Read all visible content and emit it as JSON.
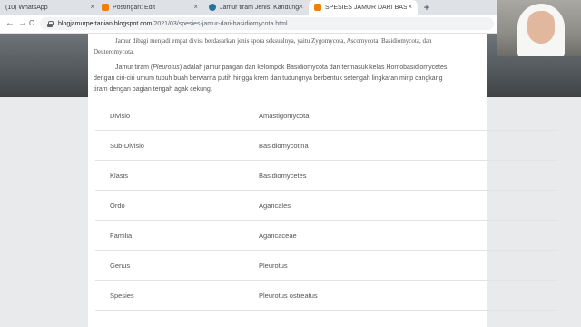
{
  "browser": {
    "tabs": [
      {
        "title": "(10) WhatsApp",
        "icon": "whatsapp-icon",
        "active": false
      },
      {
        "title": "Postingan: Edit",
        "icon": "blogger-icon",
        "active": false
      },
      {
        "title": "Jamur tiram Jenis, Kandungan, M",
        "icon": "wordpress-icon",
        "active": false
      },
      {
        "title": "SPESIES JAMUR DARI BASIDIOM",
        "icon": "blogger-icon",
        "active": true
      }
    ],
    "close_glyph": "×",
    "new_tab_glyph": "+",
    "back_glyph": "←",
    "forward_glyph": "→",
    "reload_glyph": "C",
    "url_host": "blogjamurpertanian.blogspot.com",
    "url_path": "/2021/03/spesies-jamur-dari-basidiomycota.html"
  },
  "article": {
    "para1": "Jamur dibagi menjadi empat divisi berdasarkan jenis spora seksualnya, yaitu Zygomycota, Ascomycota, Basidiomycota, dan Deuteromycota.",
    "para2_before": "Jamur tiram (",
    "para2_italic": "Pleurotus",
    "para2_after": ") adalah jamur pangan dari kelompok Basidiomycota dan termasuk kelas Homobasidiomycetes dengan ciri-ciri umum tubuh buah berwarna putih hingga krem dan tudungnya berbentuk setengah lingkaran mirip cangkang tiram dengan bagian tengah agak cekung.",
    "taxonomy": [
      {
        "rank": "Divisio",
        "value": "Amastigomycota"
      },
      {
        "rank": "Sub-Divisio",
        "value": "Basidiomycotina"
      },
      {
        "rank": "Klasis",
        "value": "Basidiomycetes"
      },
      {
        "rank": "Ordo",
        "value": "Agaricales"
      },
      {
        "rank": "Familia",
        "value": "Agaricaceae"
      },
      {
        "rank": "Genus",
        "value": "Pleurotus"
      },
      {
        "rank": "Spesies",
        "value": "Pleurotus ostreatus"
      }
    ]
  },
  "colors": {
    "tabstrip": "#dee1e6",
    "banner": "#5a5f63",
    "page_bg": "#e9eaeb",
    "text": "#555555",
    "blogger_orange": "#f57d00",
    "wordpress_blue": "#21759b"
  }
}
